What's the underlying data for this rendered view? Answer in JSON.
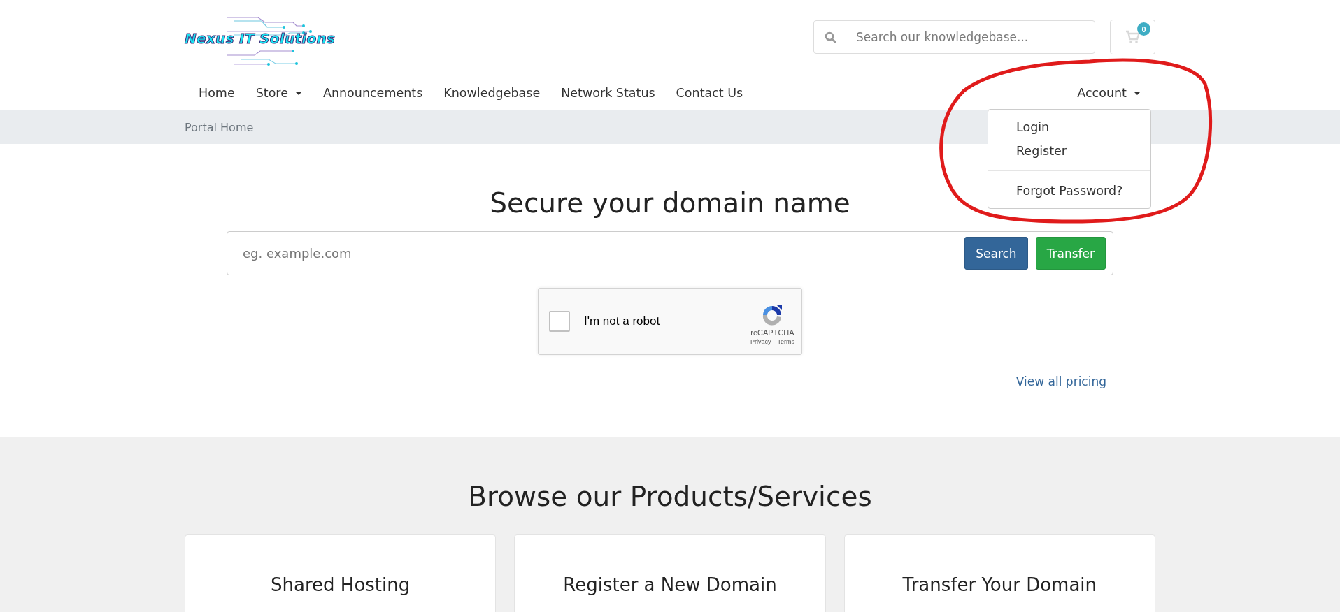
{
  "header": {
    "logo": "Nexus IT Solutions",
    "search": {
      "placeholder": "Search our knowledgebase..."
    },
    "cart": {
      "count": "0"
    }
  },
  "nav": {
    "items": [
      {
        "label": "Home",
        "dropdown": false
      },
      {
        "label": "Store",
        "dropdown": true
      },
      {
        "label": "Announcements",
        "dropdown": false
      },
      {
        "label": "Knowledgebase",
        "dropdown": false
      },
      {
        "label": "Network Status",
        "dropdown": false
      },
      {
        "label": "Contact Us",
        "dropdown": false
      }
    ],
    "account": {
      "label": "Account",
      "expanded": true,
      "menu": [
        [
          "Login",
          "Register"
        ],
        [
          "Forgot Password?"
        ]
      ]
    }
  },
  "breadcrumb": [
    "Portal Home"
  ],
  "domain": {
    "heading": "Secure your domain name",
    "placeholder": "eg. example.com",
    "buttons": [
      {
        "label": "Search",
        "kind": "primary"
      },
      {
        "label": "Transfer",
        "kind": "success"
      }
    ],
    "captcha": {
      "label": "I'm not a robot",
      "checked": false,
      "brand": "reCAPTCHA",
      "privacy": "Privacy",
      "separator": "-",
      "terms": "Terms"
    },
    "pricing_link": "View all pricing"
  },
  "products": {
    "heading": "Browse our Products/Services",
    "cards": [
      "Shared Hosting",
      "Register a New Domain",
      "Transfer Your Domain"
    ]
  }
}
